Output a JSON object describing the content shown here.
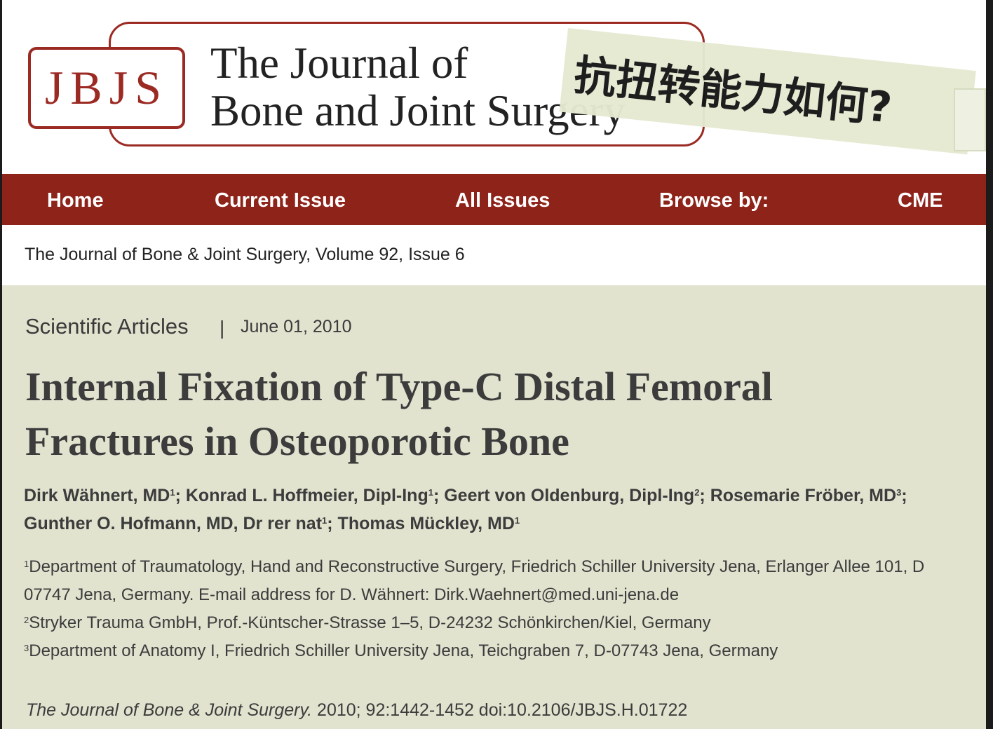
{
  "logo": {
    "abbreviation": "JBJS",
    "title_line1": "The Journal of",
    "title_line2": "Bone and Joint Surgery"
  },
  "overlay": {
    "text": "抗扭转能力如何?"
  },
  "nav": {
    "items": [
      {
        "label": "Home"
      },
      {
        "label": "Current Issue"
      },
      {
        "label": "All Issues"
      },
      {
        "label": "Browse by:"
      },
      {
        "label": "CME"
      }
    ],
    "color": "#8e2319"
  },
  "breadcrumb": "The Journal of Bone & Joint Surgery, Volume 92, Issue 6",
  "article": {
    "section": "Scientific Articles",
    "separator": "|",
    "date": "June 01, 2010",
    "title_line1": "Internal Fixation of Type-C Distal Femoral",
    "title_line2": "Fractures in Osteoporotic Bone",
    "authors": [
      {
        "name": "Dirk Wähnert, MD",
        "sup": "1",
        "sep": "; "
      },
      {
        "name": "Konrad L. Hoffmeier, Dipl-Ing",
        "sup": "1",
        "sep": "; "
      },
      {
        "name": "Geert von Oldenburg, Dipl-Ing",
        "sup": "2",
        "sep": "; "
      },
      {
        "name": "Rosemarie Fröber, MD",
        "sup": "3",
        "sep": ";"
      },
      {
        "name": "Gunther O. Hofmann, MD, Dr rer nat",
        "sup": "1",
        "sep": "; "
      },
      {
        "name": "Thomas Mückley, MD",
        "sup": "1",
        "sep": ""
      }
    ],
    "affiliations": [
      {
        "sup": "1",
        "text": "Department of Traumatology, Hand and Reconstructive Surgery, Friedrich Schiller University Jena, Erlanger Allee 101, D"
      },
      {
        "sup": "",
        "text": "07747 Jena, Germany. E-mail address for D. Wähnert: Dirk.Waehnert@med.uni-jena.de"
      },
      {
        "sup": "2",
        "text": "Stryker Trauma GmbH, Prof.-Küntscher-Strasse 1–5, D-24232 Schönkirchen/Kiel, Germany"
      },
      {
        "sup": "3",
        "text": "Department of Anatomy I, Friedrich Schiller University Jena, Teichgraben 7, D-07743 Jena, Germany"
      }
    ],
    "citation_journal": "The Journal of Bone & Joint Surgery.",
    "citation_rest": "2010; 92:1442-1452  doi:10.2106/JBJS.H.01722"
  }
}
